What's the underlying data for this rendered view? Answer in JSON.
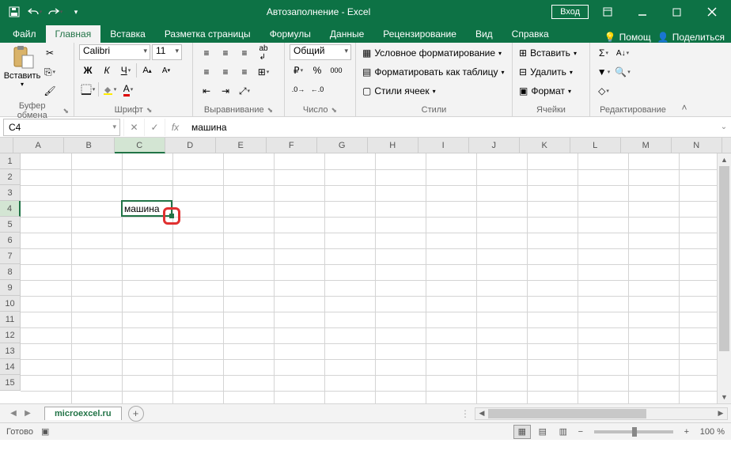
{
  "titlebar": {
    "title": "Автозаполнение  -  Excel",
    "login": "Вход"
  },
  "tabs": {
    "file": "Файл",
    "home": "Главная",
    "insert": "Вставка",
    "layout": "Разметка страницы",
    "formulas": "Формулы",
    "data": "Данные",
    "review": "Рецензирование",
    "view": "Вид",
    "help": "Справка",
    "tellme": "Помощ",
    "share": "Поделиться"
  },
  "ribbon": {
    "clipboard": {
      "label": "Буфер обмена",
      "paste": "Вставить"
    },
    "font": {
      "label": "Шрифт",
      "name": "Calibri",
      "size": "11"
    },
    "alignment": {
      "label": "Выравнивание"
    },
    "number": {
      "label": "Число",
      "format": "Общий"
    },
    "styles": {
      "label": "Стили",
      "conditional": "Условное форматирование",
      "table": "Форматировать как таблицу",
      "cell": "Стили ячеек"
    },
    "cells": {
      "label": "Ячейки",
      "insert": "Вставить",
      "delete": "Удалить",
      "format": "Формат"
    },
    "editing": {
      "label": "Редактирование"
    }
  },
  "formula": {
    "cellref": "C4",
    "fx": "fx",
    "value": "машина"
  },
  "grid": {
    "columns": [
      "A",
      "B",
      "C",
      "D",
      "E",
      "F",
      "G",
      "H",
      "I",
      "J",
      "K",
      "L",
      "M",
      "N"
    ],
    "rows": [
      "1",
      "2",
      "3",
      "4",
      "5",
      "6",
      "7",
      "8",
      "9",
      "10",
      "11",
      "12",
      "13",
      "14",
      "15"
    ],
    "selected_col_index": 2,
    "selected_row_index": 3,
    "selected_value": "машина"
  },
  "sheet": {
    "name": "microexcel.ru"
  },
  "status": {
    "ready": "Готово",
    "zoom": "100 %"
  }
}
